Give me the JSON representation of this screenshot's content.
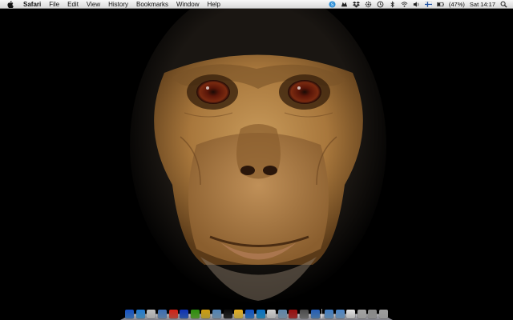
{
  "menubar": {
    "app_name": "Safari",
    "items": [
      "File",
      "Edit",
      "View",
      "History",
      "Bookmarks",
      "Window",
      "Help"
    ],
    "status": {
      "battery_label": "(47%)",
      "clock": "Sat 14:17"
    },
    "status_icons": [
      "skype-icon",
      "growl-icon",
      "dropbox-icon",
      "gear-icon",
      "time-machine-icon",
      "bluetooth-icon",
      "wifi-icon",
      "volume-icon",
      "flag-icon",
      "battery-icon",
      "spotlight-icon"
    ]
  },
  "desktop": {
    "wallpaper": "chimpanzee-portrait"
  },
  "dock": {
    "apps": [
      {
        "name": "finder-icon",
        "color": "#4a8fe0"
      },
      {
        "name": "safari-icon",
        "color": "#5ab0e8"
      },
      {
        "name": "clock-icon",
        "color": "#dddddd"
      },
      {
        "name": "preview-icon",
        "color": "#7aa6d6"
      },
      {
        "name": "calendar-icon",
        "color": "#e85c4a"
      },
      {
        "name": "itunes-icon",
        "color": "#3a6fd8"
      },
      {
        "name": "spotify-icon",
        "color": "#6abf3a"
      },
      {
        "name": "chrome-icon",
        "color": "#e6c840"
      },
      {
        "name": "iphoto-icon",
        "color": "#8fb6d8"
      },
      {
        "name": "terminal-icon",
        "color": "#333333"
      },
      {
        "name": "notes-icon",
        "color": "#f2d35a"
      },
      {
        "name": "dropbox-icon",
        "color": "#3f8fe0"
      },
      {
        "name": "skype-icon",
        "color": "#2fa8e0"
      },
      {
        "name": "text-edit-icon",
        "color": "#e6e6e6"
      },
      {
        "name": "mail-icon",
        "color": "#9ab8d0"
      },
      {
        "name": "photo-booth-icon",
        "color": "#c43a3a"
      },
      {
        "name": "system-preferences-icon",
        "color": "#8a8a8a"
      },
      {
        "name": "app-store-icon",
        "color": "#5f9ad8"
      }
    ],
    "folders": [
      {
        "name": "applications-folder-icon",
        "color": "#7fb2e0"
      },
      {
        "name": "documents-folder-icon",
        "color": "#8ab8e2"
      },
      {
        "name": "document-icon",
        "color": "#f0f0f0"
      },
      {
        "name": "downloads-stack-icon",
        "color": "#cccccc"
      },
      {
        "name": "file-stack-icon",
        "color": "#bbbbbb"
      },
      {
        "name": "trash-icon",
        "color": "#c8c8c8"
      }
    ]
  }
}
